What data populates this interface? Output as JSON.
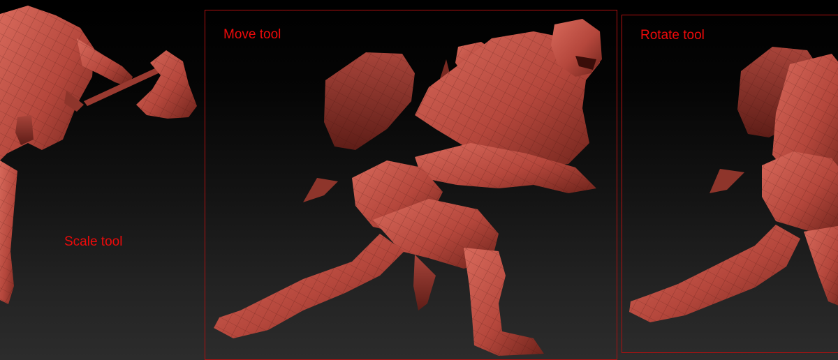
{
  "panels": {
    "scale": {
      "label": "Scale tool"
    },
    "move": {
      "label": "Move tool"
    },
    "rotate": {
      "label": "Rotate tool"
    }
  },
  "colors": {
    "background_top": "#000000",
    "background_bottom": "#2c2c2c",
    "frame": "#b01010",
    "label_text": "#ee0a0a",
    "model_base": "#b5473c",
    "model_highlight": "#d86a5c",
    "model_shadow": "#5e1d17"
  },
  "icons": {
    "scale_figure": "orc-warrior-axe-model",
    "move_figure": "orc-warrior-running-model",
    "rotate_figure": "orc-warrior-running-model-partial"
  }
}
